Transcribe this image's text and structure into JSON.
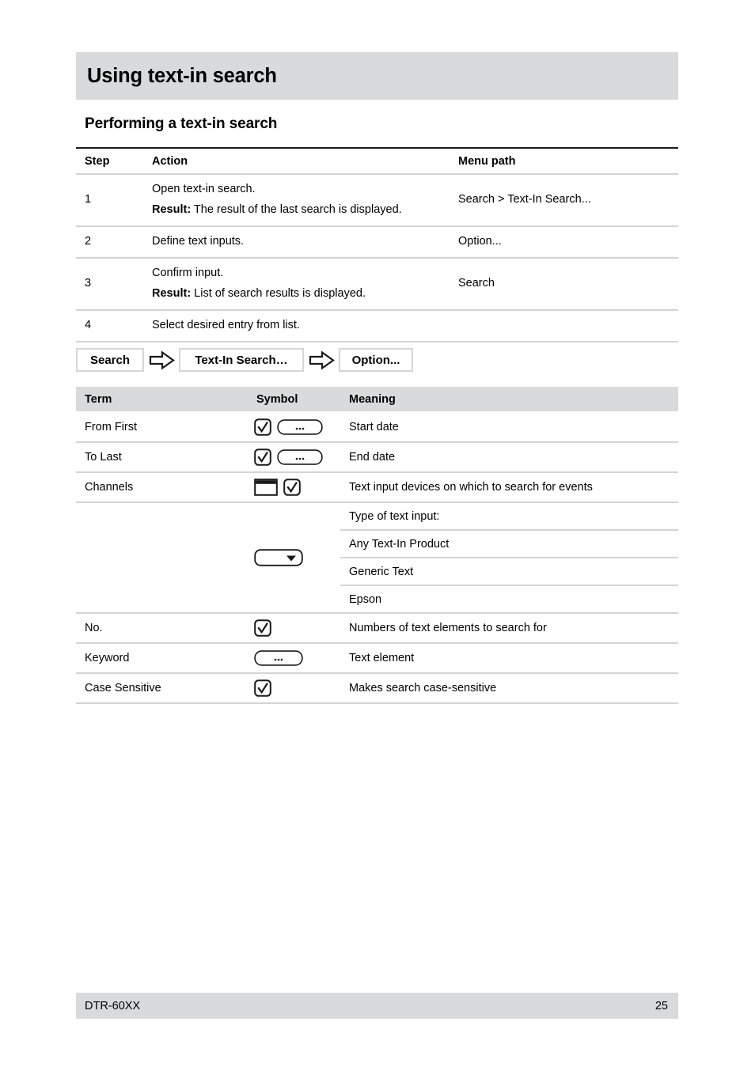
{
  "document": {
    "chapter_title": "Using text-in search",
    "section_heading": "Performing a text-in search"
  },
  "steps_table": {
    "headers": [
      "Step",
      "Action",
      "Menu path"
    ],
    "rows": [
      {
        "step": "1",
        "action_line1": "Open text-in search.",
        "result_label": "Result:",
        "action_line2": " The result of the last search is displayed.",
        "menu": "Search  > Text-In Search..."
      },
      {
        "step": "2",
        "action_line1": "Define text inputs.",
        "result_label": "",
        "action_line2": "",
        "menu": "Option..."
      },
      {
        "step": "3",
        "action_line1": "Confirm input.",
        "result_label": "Result:",
        "action_line2": " List of search results is displayed.",
        "menu": "Search"
      },
      {
        "step": "4",
        "action_line1": "Select desired entry from list.",
        "result_label": "",
        "action_line2": "",
        "menu": ""
      }
    ]
  },
  "flow": {
    "step1": "Search",
    "step2": "Text-In Search…",
    "step3": "Option...",
    "arrow_icon": "block-arrow-right-icon"
  },
  "terms_table": {
    "headers": [
      "Term",
      "Symbol",
      "Meaning"
    ],
    "rows": [
      {
        "term": "From First",
        "symbols": [
          "checkbox-checked",
          "ellipsis-button"
        ],
        "meaning": "Start date"
      },
      {
        "term": "To Last",
        "symbols": [
          "checkbox-checked",
          "ellipsis-button"
        ],
        "meaning": "End date"
      },
      {
        "term": "Channels",
        "symbols": [
          "screen-icon",
          "checkbox-checked"
        ],
        "meaning": "Text input devices on which to search for events"
      },
      {
        "term": "",
        "symbols": [
          "dropdown"
        ],
        "meaning": "Type of text input:"
      },
      {
        "term": "",
        "symbols": [],
        "meaning": "Any Text-In Product"
      },
      {
        "term": "",
        "symbols": [],
        "meaning": "Generic Text"
      },
      {
        "term": "",
        "symbols": [],
        "meaning": "Epson"
      },
      {
        "term": "No.",
        "symbols": [
          "checkbox-checked"
        ],
        "meaning": "Numbers of text elements to search for"
      },
      {
        "term": "Keyword",
        "symbols": [
          "ellipsis-button"
        ],
        "meaning": "Text element"
      },
      {
        "term": "Case Sensitive",
        "symbols": [
          "checkbox-checked"
        ],
        "meaning": "Makes search case-sensitive"
      }
    ],
    "ellipsis_label": "..."
  },
  "footer": {
    "model": "DTR-60XX",
    "page_number": "25"
  },
  "colors": {
    "band_gray": "#d9dadb",
    "rule_gray": "#d4d4d4",
    "rule_dark": "#1a1a1a",
    "text": "#000000"
  }
}
